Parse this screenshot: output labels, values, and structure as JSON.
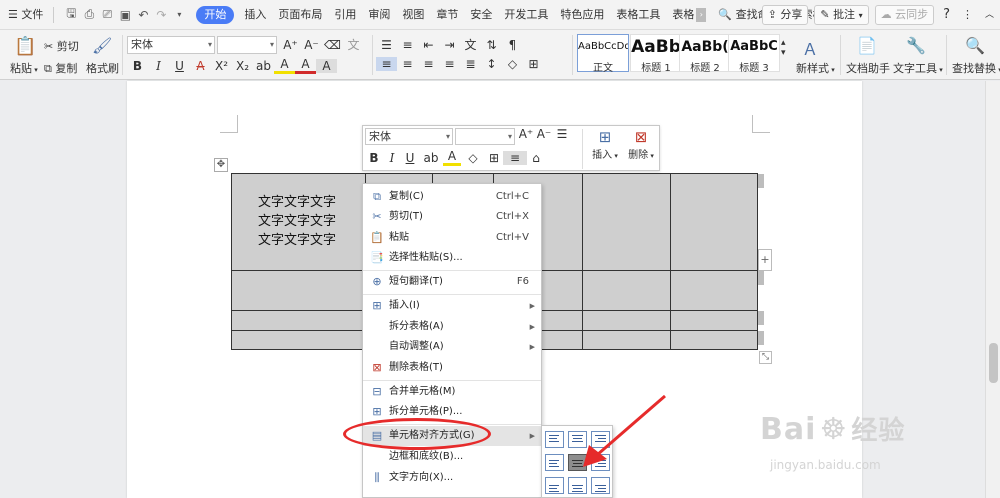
{
  "menubar": {
    "file": "文件",
    "tabs": [
      "开始",
      "插入",
      "页面布局",
      "引用",
      "审阅",
      "视图",
      "章节",
      "安全",
      "开发工具",
      "特色应用",
      "表格工具",
      "表格"
    ],
    "search": "查找命令、搜索模板",
    "share": "分享",
    "comment": "批注",
    "cloud": "云同步",
    "help": "?"
  },
  "ribbon": {
    "paste": "粘贴",
    "cut": "剪切",
    "copy": "复制",
    "format_painter": "格式刷",
    "font_name": "宋体",
    "font_size": "",
    "styles": [
      {
        "sample": "AaBbCcDd",
        "name": "正文"
      },
      {
        "sample": "AaBb",
        "name": "标题 1"
      },
      {
        "sample": "AaBb(",
        "name": "标题 2"
      },
      {
        "sample": "AaBbC",
        "name": "标题 3"
      }
    ],
    "new_style": "新样式",
    "doc_helper": "文档助手",
    "text_tools": "文字工具",
    "find_replace": "查找替换"
  },
  "table": {
    "cell_text": [
      "文字文字文字",
      "文字文字文字",
      "文字文字文字"
    ]
  },
  "mini_toolbar": {
    "font_name": "宋体",
    "font_size": "",
    "insert": "插入",
    "delete": "删除"
  },
  "context_menu": {
    "items": [
      {
        "label": "复制(C)",
        "shortcut": "Ctrl+C"
      },
      {
        "label": "剪切(T)",
        "shortcut": "Ctrl+X"
      },
      {
        "label": "粘贴",
        "shortcut": "Ctrl+V"
      },
      {
        "label": "选择性粘贴(S)...",
        "shortcut": ""
      },
      {
        "label": "短句翻译(T)",
        "shortcut": "F6"
      },
      {
        "label": "插入(I)",
        "shortcut": ""
      },
      {
        "label": "拆分表格(A)",
        "shortcut": ""
      },
      {
        "label": "自动调整(A)",
        "shortcut": ""
      },
      {
        "label": "删除表格(T)",
        "shortcut": ""
      },
      {
        "label": "合并单元格(M)",
        "shortcut": ""
      },
      {
        "label": "拆分单元格(P)...",
        "shortcut": ""
      },
      {
        "label": "单元格对齐方式(G)",
        "shortcut": ""
      },
      {
        "label": "边框和底纹(B)...",
        "shortcut": ""
      },
      {
        "label": "文字方向(X)...",
        "shortcut": ""
      }
    ]
  },
  "alignment_submenu": {
    "selected": "middle-center"
  },
  "watermark": {
    "brand": "Bai",
    "brand2": "经验",
    "url": "jingyan.baidu.com"
  },
  "colors": {
    "accent": "#4a7cf6",
    "annotation": "#e62b2b",
    "table_fill": "#cfcfcf"
  }
}
